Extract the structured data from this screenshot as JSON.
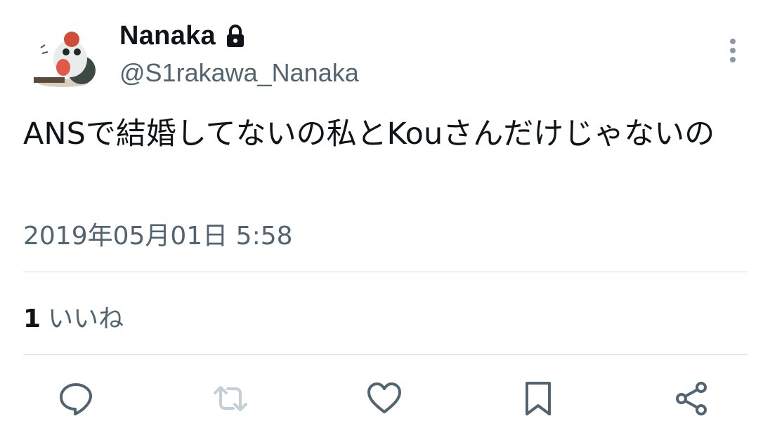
{
  "user": {
    "display_name": "Nanaka",
    "handle": "@S1rakawa_Nanaka",
    "protected": true
  },
  "tweet": {
    "text": "ANSで結婚してないの私とKouさんだけじゃないの",
    "timestamp": "2019年05月01日 5:58"
  },
  "stats": {
    "likes_count": "1",
    "likes_label": "いいね"
  },
  "actions": [
    "reply-icon",
    "retweet-icon",
    "like-icon",
    "bookmark-icon",
    "share-icon"
  ],
  "colors": {
    "text": "#0f1419",
    "secondary": "#536471",
    "divider": "#cfd9de",
    "retweet_disabled": "#c4cfd6"
  }
}
